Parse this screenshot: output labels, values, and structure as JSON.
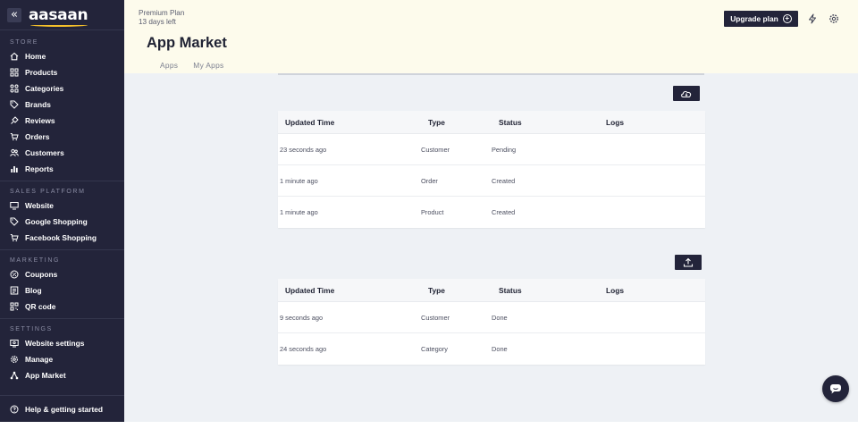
{
  "sidebar": {
    "brand": "aasaan",
    "collapse_glyph": "«",
    "sections": [
      {
        "title": "STORE",
        "items": [
          {
            "label": "Home",
            "icon": "home-icon"
          },
          {
            "label": "Products",
            "icon": "products-icon"
          },
          {
            "label": "Categories",
            "icon": "categories-icon"
          },
          {
            "label": "Brands",
            "icon": "tag-icon"
          },
          {
            "label": "Reviews",
            "icon": "reviews-icon"
          },
          {
            "label": "Orders",
            "icon": "cart-icon"
          },
          {
            "label": "Customers",
            "icon": "customers-icon"
          },
          {
            "label": "Reports",
            "icon": "reports-icon"
          }
        ]
      },
      {
        "title": "SALES PLATFORM",
        "items": [
          {
            "label": "Website",
            "icon": "monitor-icon"
          },
          {
            "label": "Google Shopping",
            "icon": "tag-icon"
          },
          {
            "label": "Facebook Shopping",
            "icon": "cart-icon"
          }
        ]
      },
      {
        "title": "MARKETING",
        "items": [
          {
            "label": "Coupons",
            "icon": "coupon-icon"
          },
          {
            "label": "Blog",
            "icon": "blog-icon"
          },
          {
            "label": "QR code",
            "icon": "qr-icon"
          }
        ]
      },
      {
        "title": "SETTINGS",
        "items": [
          {
            "label": "Website settings",
            "icon": "website-settings-icon"
          },
          {
            "label": "Manage",
            "icon": "gear-icon"
          },
          {
            "label": "App Market",
            "icon": "app-market-icon"
          }
        ]
      }
    ],
    "help_label": "Help & getting started"
  },
  "header": {
    "plan_name": "Premium Plan",
    "plan_days": "13 days left",
    "title": "App Market",
    "tabs": [
      "Apps",
      "My Apps"
    ],
    "upgrade_label": "Upgrade plan",
    "upgrade_glyph": "+"
  },
  "import_table": {
    "columns": [
      "Updated Time",
      "Type",
      "Status",
      "Logs"
    ],
    "rows": [
      [
        "23 seconds ago",
        "Customer",
        "Pending",
        ""
      ],
      [
        "1 minute ago",
        "Order",
        "Created",
        ""
      ],
      [
        "1 minute ago",
        "Product",
        "Created",
        ""
      ]
    ]
  },
  "export_table": {
    "columns": [
      "Updated Time",
      "Type",
      "Status",
      "Logs"
    ],
    "rows": [
      [
        "9 seconds ago",
        "Customer",
        "Done",
        ""
      ],
      [
        "24 seconds ago",
        "Category",
        "Done",
        ""
      ]
    ]
  },
  "colors": {
    "sidebar_bg": "#23243a",
    "header_bg": "#fdfbec",
    "main_bg": "#eef1f5",
    "logo_accent": "#f6c12b"
  }
}
